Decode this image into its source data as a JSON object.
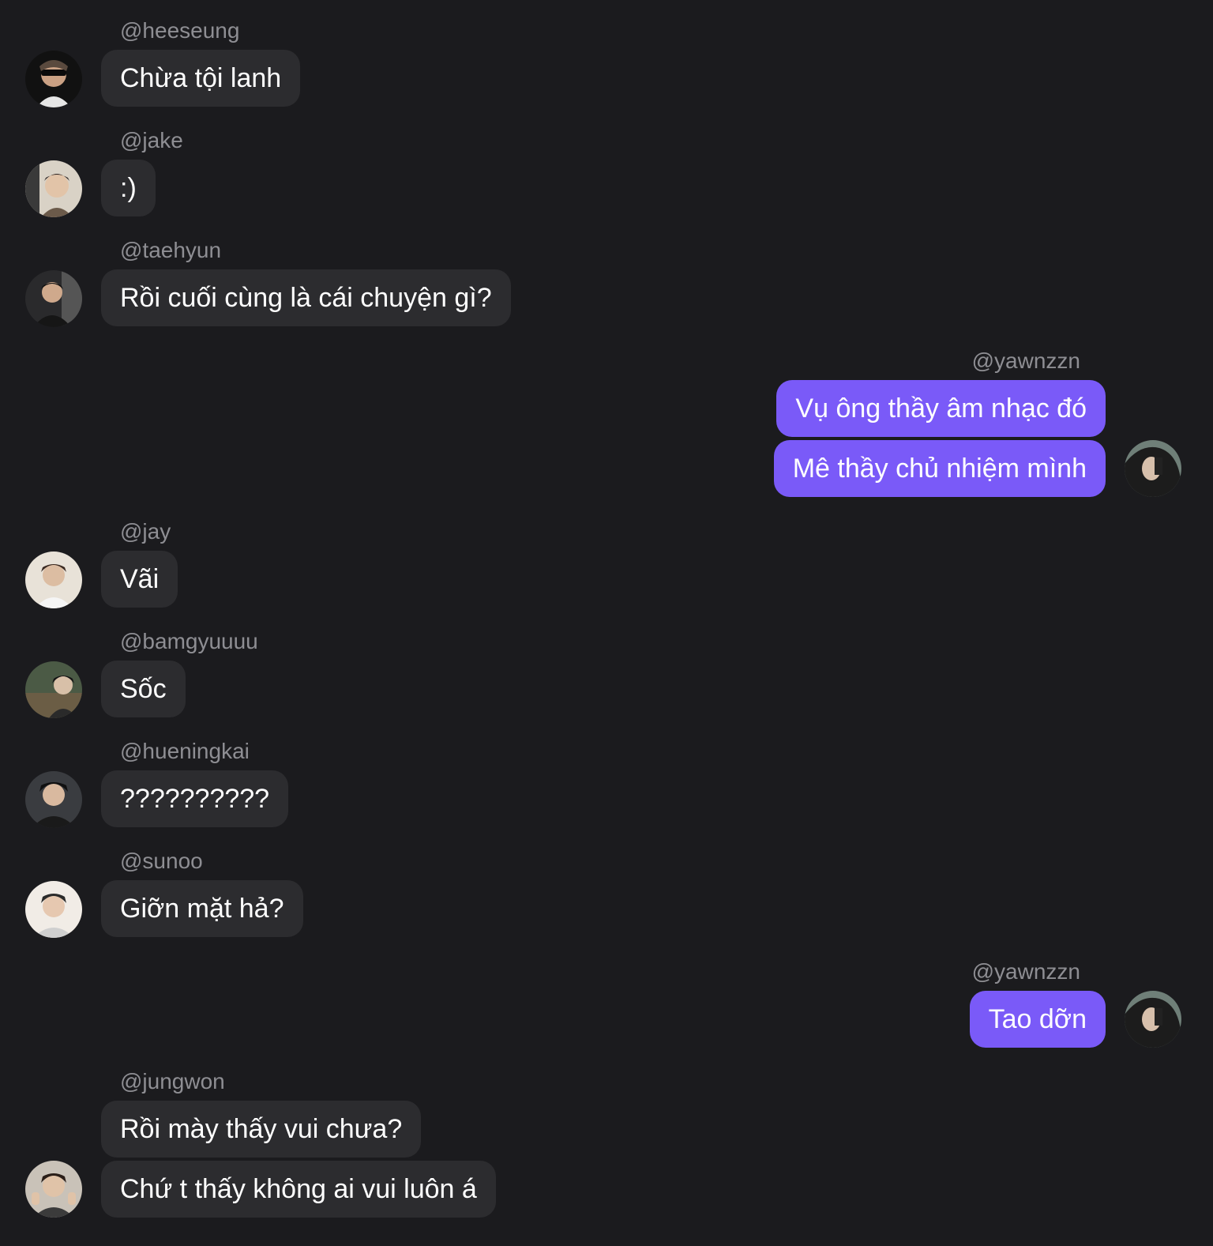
{
  "messages": [
    {
      "username": "@heeseung",
      "text": "Chừa tội lanh"
    },
    {
      "username": "@jake",
      "text": ":)"
    },
    {
      "username": "@taehyun",
      "text": "Rồi cuối cùng là cái chuyện gì?"
    },
    {
      "username": "@yawnzzn",
      "texts": [
        "Vụ ông thầy âm nhạc đó",
        "Mê thầy chủ nhiệm mình"
      ]
    },
    {
      "username": "@jay",
      "text": "Vãi"
    },
    {
      "username": "@bamgyuuuu",
      "text": "Sốc"
    },
    {
      "username": "@hueningkai",
      "text": "??????????"
    },
    {
      "username": "@sunoo",
      "text": "Giỡn mặt hả?"
    },
    {
      "username": "@yawnzzn",
      "text": "Tao dỡn"
    },
    {
      "username": "@jungwon",
      "texts": [
        "Rồi mày thấy vui chưa?",
        "Chứ t thấy không ai vui luôn á"
      ]
    }
  ],
  "colors": {
    "background": "#1b1b1e",
    "incoming_bubble": "#2c2c2f",
    "outgoing_bubble": "#7a5af8",
    "username": "#8e8e93"
  }
}
